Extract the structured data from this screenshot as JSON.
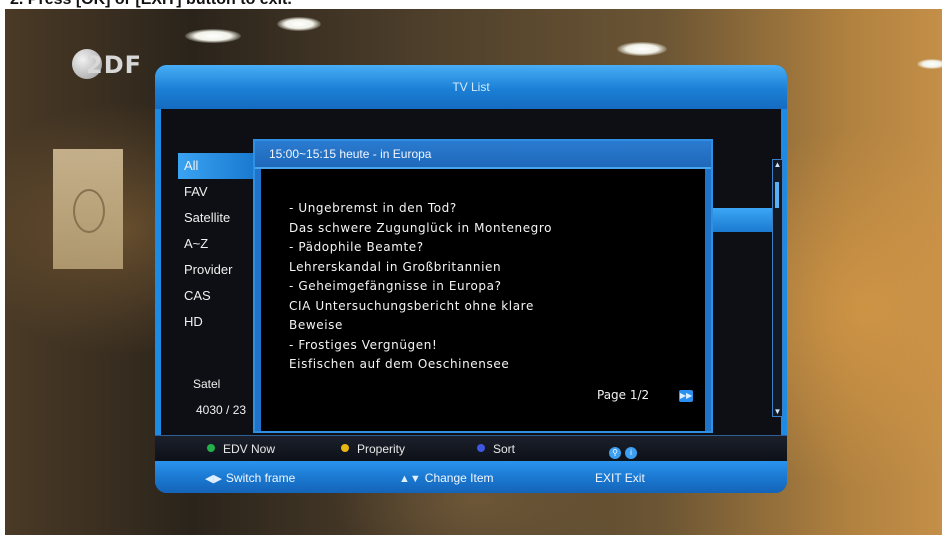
{
  "header_text": "2. Press [OK] or [EXIT] button to exit.",
  "channel_logo": "2DF",
  "window": {
    "title": "TV List"
  },
  "categories": [
    {
      "label": "All"
    },
    {
      "label": "FAV"
    },
    {
      "label": "Satellite"
    },
    {
      "label": "A~Z"
    },
    {
      "label": "Provider"
    },
    {
      "label": "CAS"
    },
    {
      "label": "HD"
    }
  ],
  "status": {
    "satellite": "Satel",
    "count": "4030 / 23"
  },
  "event_popup": {
    "time_title": "15:00~15:15  heute - in Europa",
    "lines": [
      " - Ungebremst in den Tod?",
      "Das schwere Zugunglück in Montenegro",
      " - Pädophile Beamte?",
      "Lehrerskandal in Großbritannien",
      " - Geheimgefängnisse in Europa?",
      "CIA Untersuchungsbericht ohne klare",
      "Beweise",
      " - Frostiges Vergnügen!",
      "Eisfischen auf dem Oeschinensee"
    ],
    "page": "Page 1/2"
  },
  "color_keys": [
    {
      "label": "EDV Now",
      "color": "#23b24a"
    },
    {
      "label": "Properity",
      "color": "#e8b513"
    },
    {
      "label": "Sort",
      "color": "#3f57e0"
    }
  ],
  "nav_keys": [
    {
      "label": "Switch frame",
      "glyph": "◀▶"
    },
    {
      "label": "Change Item",
      "glyph": "▲▼"
    },
    {
      "label": "EXIT Exit",
      "glyph": ""
    }
  ],
  "colors": {
    "accent_blue": "#1f8fe6",
    "panel_dark": "#0e0f14"
  }
}
